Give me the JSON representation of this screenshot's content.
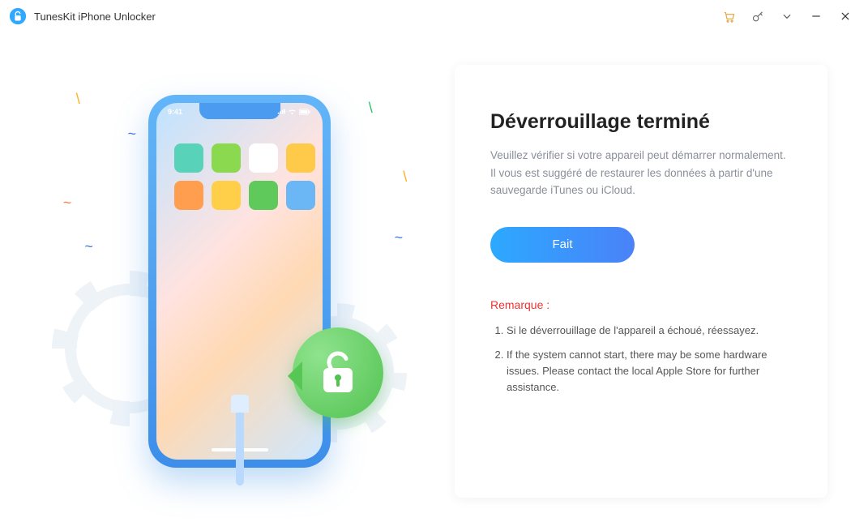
{
  "titlebar": {
    "app_name": "TunesKit iPhone Unlocker"
  },
  "illustration": {
    "clock": "9:41"
  },
  "panel": {
    "heading": "Déverrouillage terminé",
    "description": "Veuillez vérifier si votre appareil peut démarrer normalement. Il vous est suggéré de restaurer les données à partir d'une sauvegarde iTunes ou iCloud.",
    "done_label": "Fait",
    "note_label": "Remarque :",
    "notes": [
      "Si le déverrouillage de l'appareil a échoué, réessayez.",
      "If the system cannot start, there may be some hardware issues. Please contact the local Apple Store for further assistance."
    ]
  }
}
